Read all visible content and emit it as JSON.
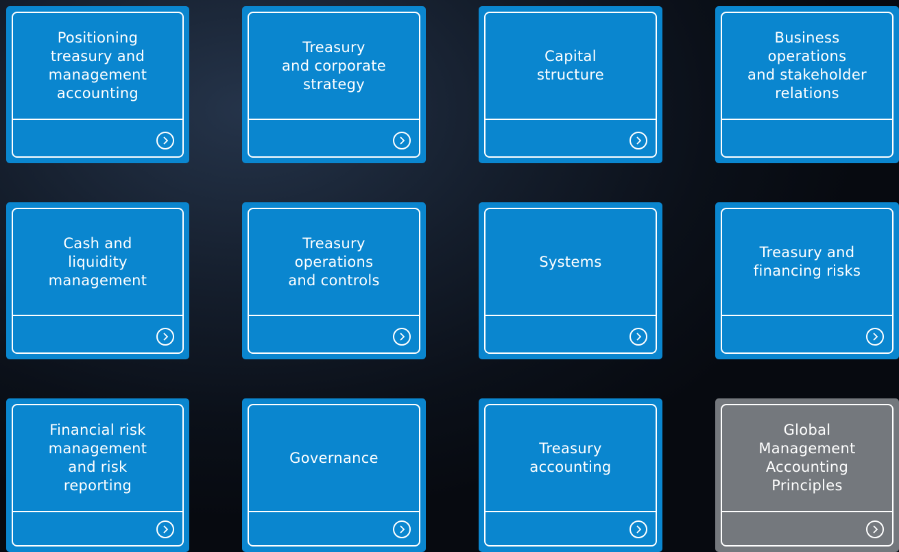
{
  "tiles": [
    {
      "title": "Positioning\ntreasury and\nmanagement\naccounting",
      "arrow": "chevron-right-circle-icon",
      "color": "#0a86cf"
    },
    {
      "title": "Treasury\nand corporate\nstrategy",
      "arrow": "chevron-right-circle-icon",
      "color": "#0a86cf"
    },
    {
      "title": "Capital\nstructure",
      "arrow": "chevron-right-circle-icon",
      "color": "#0a86cf"
    },
    {
      "title": "Business\noperations\nand stakeholder\nrelations",
      "arrow": "",
      "color": "#0a86cf"
    },
    {
      "title": "Cash and\nliquidity\nmanagement",
      "arrow": "chevron-right-circle-icon",
      "color": "#0a86cf"
    },
    {
      "title": "Treasury\noperations\nand controls",
      "arrow": "chevron-right-circle-icon",
      "color": "#0a86cf"
    },
    {
      "title": "Systems",
      "arrow": "chevron-right-circle-icon",
      "color": "#0a86cf"
    },
    {
      "title": "Treasury and\nfinancing risks",
      "arrow": "chevron-right-circle-icon",
      "color": "#0a86cf"
    },
    {
      "title": "Financial risk\nmanagement\nand risk\nreporting",
      "arrow": "chevron-right-circle-icon",
      "color": "#0a86cf"
    },
    {
      "title": "Governance",
      "arrow": "chevron-right-circle-icon",
      "color": "#0a86cf"
    },
    {
      "title": "Treasury\naccounting",
      "arrow": "chevron-right-circle-icon",
      "color": "#0a86cf"
    },
    {
      "title": "Global\nManagement\nAccounting\nPrinciples",
      "arrow": "chevron-right-circle-icon",
      "color": "#74787d"
    }
  ]
}
